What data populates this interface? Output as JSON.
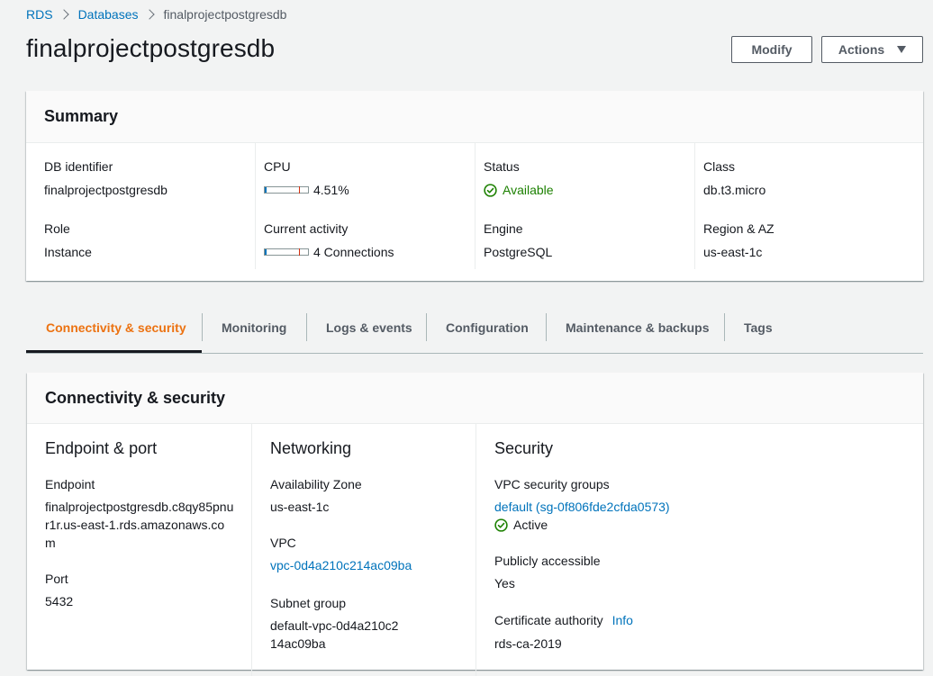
{
  "breadcrumb": {
    "items": [
      {
        "label": "RDS"
      },
      {
        "label": "Databases"
      },
      {
        "label": "finalprojectpostgresdb"
      }
    ]
  },
  "page_title": "finalprojectpostgresdb",
  "header_buttons": {
    "modify": "Modify",
    "actions": "Actions"
  },
  "summary": {
    "title": "Summary",
    "db_identifier": {
      "label": "DB identifier",
      "value": "finalprojectpostgresdb"
    },
    "role": {
      "label": "Role",
      "value": "Instance"
    },
    "cpu": {
      "label": "CPU",
      "value": "4.51%",
      "fill_fraction": 0.0451
    },
    "current_activity": {
      "label": "Current activity",
      "value": "4 Connections",
      "fill_fraction": 0.04
    },
    "status": {
      "label": "Status",
      "value": "Available"
    },
    "engine": {
      "label": "Engine",
      "value": "PostgreSQL"
    },
    "class": {
      "label": "Class",
      "value": "db.t3.micro"
    },
    "region_az": {
      "label": "Region & AZ",
      "value": "us-east-1c"
    }
  },
  "tabs": [
    {
      "label": "Connectivity & security",
      "active": true
    },
    {
      "label": "Monitoring"
    },
    {
      "label": "Logs & events"
    },
    {
      "label": "Configuration"
    },
    {
      "label": "Maintenance & backups"
    },
    {
      "label": "Tags"
    }
  ],
  "connectivity": {
    "title": "Connectivity & security",
    "endpoint_port": {
      "title": "Endpoint & port",
      "endpoint_label": "Endpoint",
      "endpoint_value": "finalprojectpostgresdb.c8qy85pnur1r.us-east-1.rds.amazonaws.com",
      "port_label": "Port",
      "port_value": "5432"
    },
    "networking": {
      "title": "Networking",
      "az_label": "Availability Zone",
      "az_value": "us-east-1c",
      "vpc_label": "VPC",
      "vpc_value": "vpc-0d4a210c214ac09ba",
      "subnet_label": "Subnet group",
      "subnet_value": "default-vpc-0d4a210c214ac09ba"
    },
    "security": {
      "title": "Security",
      "sg_label": "VPC security groups",
      "sg_value": "default (sg-0f806fde2cfda0573)",
      "sg_status": "Active",
      "public_label": "Publicly accessible",
      "public_value": "Yes",
      "cert_label": "Certificate authority",
      "cert_info": "Info",
      "cert_value": "rds-ca-2019"
    }
  },
  "colors": {
    "link": "#0073bb",
    "success": "#1d8102",
    "active_tab": "#ec7211"
  }
}
